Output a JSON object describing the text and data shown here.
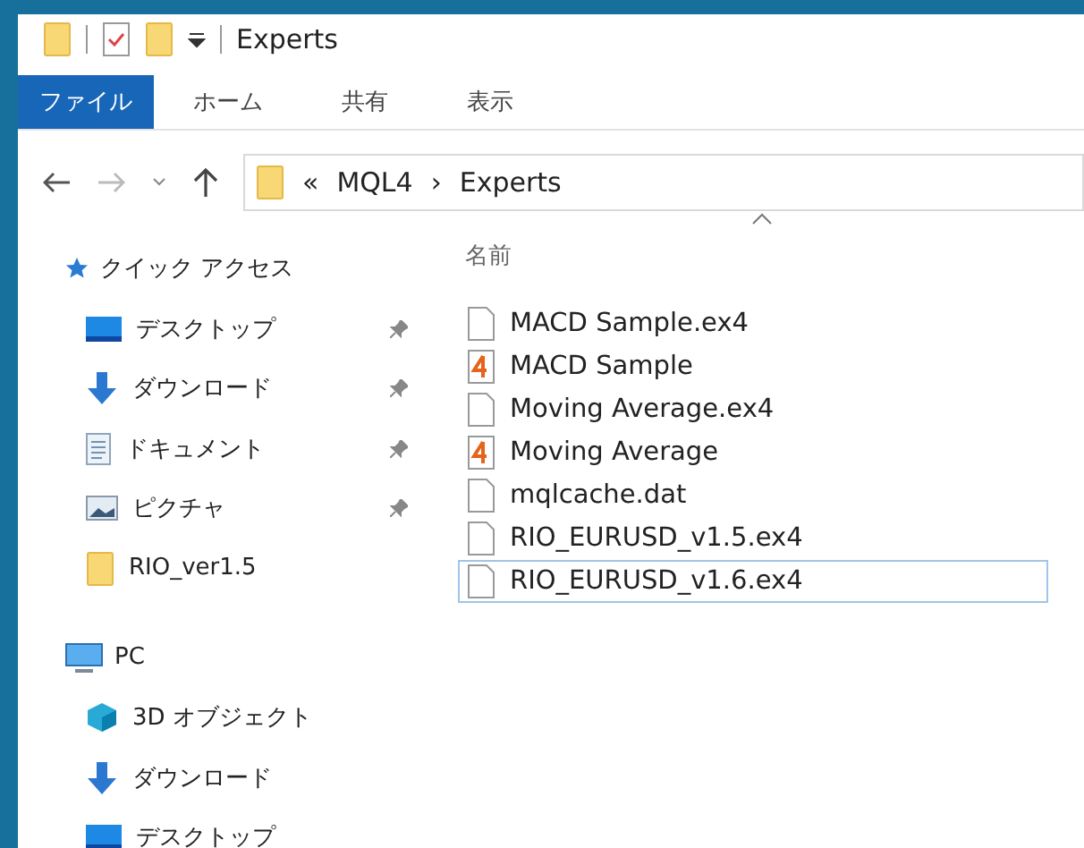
{
  "window": {
    "title": "Experts"
  },
  "ribbon_tabs": [
    {
      "label": "ファイル",
      "selected": true
    },
    {
      "label": "ホーム",
      "selected": false
    },
    {
      "label": "共有",
      "selected": false
    },
    {
      "label": "表示",
      "selected": false
    }
  ],
  "address_bar": {
    "parts": [
      "«",
      "MQL4",
      "›",
      "Experts"
    ]
  },
  "sidebar": {
    "sections": [
      {
        "label": "クイック アクセス",
        "kind": "star",
        "items": [
          {
            "label": "デスクトップ",
            "kind": "desktop",
            "pinned": true
          },
          {
            "label": "ダウンロード",
            "kind": "download",
            "pinned": true
          },
          {
            "label": "ドキュメント",
            "kind": "document",
            "pinned": true
          },
          {
            "label": "ピクチャ",
            "kind": "pictures",
            "pinned": true
          },
          {
            "label": "RIO_ver1.5",
            "kind": "folder",
            "pinned": false
          }
        ]
      },
      {
        "label": "PC",
        "kind": "pc",
        "items": [
          {
            "label": "3D オブジェクト",
            "kind": "cube",
            "pinned": false
          },
          {
            "label": "ダウンロード",
            "kind": "download",
            "pinned": false
          },
          {
            "label": "デスクトップ",
            "kind": "desktop",
            "pinned": false
          }
        ]
      }
    ]
  },
  "file_list": {
    "column": "名前",
    "files": [
      {
        "name": "MACD Sample.ex4",
        "kind": "file",
        "selected": false
      },
      {
        "name": "MACD Sample",
        "kind": "mq4",
        "selected": false
      },
      {
        "name": "Moving Average.ex4",
        "kind": "file",
        "selected": false
      },
      {
        "name": "Moving Average",
        "kind": "mq4",
        "selected": false
      },
      {
        "name": "mqlcache.dat",
        "kind": "file",
        "selected": false
      },
      {
        "name": "RIO_EURUSD_v1.5.ex4",
        "kind": "file",
        "selected": false
      },
      {
        "name": "RIO_EURUSD_v1.6.ex4",
        "kind": "file",
        "selected": true
      }
    ]
  }
}
